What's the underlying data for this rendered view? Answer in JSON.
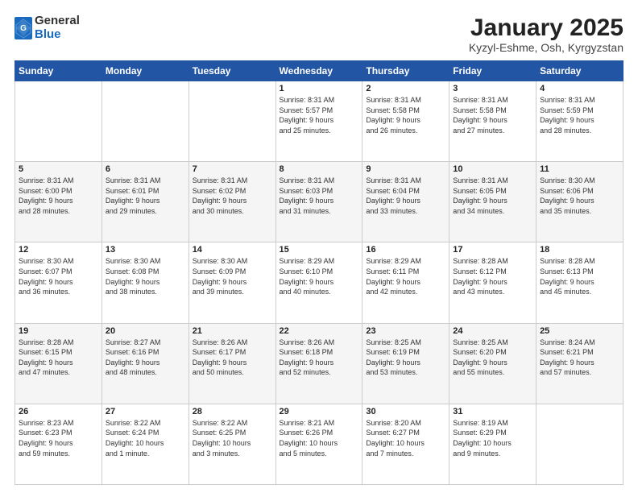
{
  "logo": {
    "general": "General",
    "blue": "Blue"
  },
  "header": {
    "title": "January 2025",
    "subtitle": "Kyzyl-Eshme, Osh, Kyrgyzstan"
  },
  "weekdays": [
    "Sunday",
    "Monday",
    "Tuesday",
    "Wednesday",
    "Thursday",
    "Friday",
    "Saturday"
  ],
  "weeks": [
    [
      {
        "day": "",
        "info": ""
      },
      {
        "day": "",
        "info": ""
      },
      {
        "day": "",
        "info": ""
      },
      {
        "day": "1",
        "info": "Sunrise: 8:31 AM\nSunset: 5:57 PM\nDaylight: 9 hours\nand 25 minutes."
      },
      {
        "day": "2",
        "info": "Sunrise: 8:31 AM\nSunset: 5:58 PM\nDaylight: 9 hours\nand 26 minutes."
      },
      {
        "day": "3",
        "info": "Sunrise: 8:31 AM\nSunset: 5:58 PM\nDaylight: 9 hours\nand 27 minutes."
      },
      {
        "day": "4",
        "info": "Sunrise: 8:31 AM\nSunset: 5:59 PM\nDaylight: 9 hours\nand 28 minutes."
      }
    ],
    [
      {
        "day": "5",
        "info": "Sunrise: 8:31 AM\nSunset: 6:00 PM\nDaylight: 9 hours\nand 28 minutes."
      },
      {
        "day": "6",
        "info": "Sunrise: 8:31 AM\nSunset: 6:01 PM\nDaylight: 9 hours\nand 29 minutes."
      },
      {
        "day": "7",
        "info": "Sunrise: 8:31 AM\nSunset: 6:02 PM\nDaylight: 9 hours\nand 30 minutes."
      },
      {
        "day": "8",
        "info": "Sunrise: 8:31 AM\nSunset: 6:03 PM\nDaylight: 9 hours\nand 31 minutes."
      },
      {
        "day": "9",
        "info": "Sunrise: 8:31 AM\nSunset: 6:04 PM\nDaylight: 9 hours\nand 33 minutes."
      },
      {
        "day": "10",
        "info": "Sunrise: 8:31 AM\nSunset: 6:05 PM\nDaylight: 9 hours\nand 34 minutes."
      },
      {
        "day": "11",
        "info": "Sunrise: 8:30 AM\nSunset: 6:06 PM\nDaylight: 9 hours\nand 35 minutes."
      }
    ],
    [
      {
        "day": "12",
        "info": "Sunrise: 8:30 AM\nSunset: 6:07 PM\nDaylight: 9 hours\nand 36 minutes."
      },
      {
        "day": "13",
        "info": "Sunrise: 8:30 AM\nSunset: 6:08 PM\nDaylight: 9 hours\nand 38 minutes."
      },
      {
        "day": "14",
        "info": "Sunrise: 8:30 AM\nSunset: 6:09 PM\nDaylight: 9 hours\nand 39 minutes."
      },
      {
        "day": "15",
        "info": "Sunrise: 8:29 AM\nSunset: 6:10 PM\nDaylight: 9 hours\nand 40 minutes."
      },
      {
        "day": "16",
        "info": "Sunrise: 8:29 AM\nSunset: 6:11 PM\nDaylight: 9 hours\nand 42 minutes."
      },
      {
        "day": "17",
        "info": "Sunrise: 8:28 AM\nSunset: 6:12 PM\nDaylight: 9 hours\nand 43 minutes."
      },
      {
        "day": "18",
        "info": "Sunrise: 8:28 AM\nSunset: 6:13 PM\nDaylight: 9 hours\nand 45 minutes."
      }
    ],
    [
      {
        "day": "19",
        "info": "Sunrise: 8:28 AM\nSunset: 6:15 PM\nDaylight: 9 hours\nand 47 minutes."
      },
      {
        "day": "20",
        "info": "Sunrise: 8:27 AM\nSunset: 6:16 PM\nDaylight: 9 hours\nand 48 minutes."
      },
      {
        "day": "21",
        "info": "Sunrise: 8:26 AM\nSunset: 6:17 PM\nDaylight: 9 hours\nand 50 minutes."
      },
      {
        "day": "22",
        "info": "Sunrise: 8:26 AM\nSunset: 6:18 PM\nDaylight: 9 hours\nand 52 minutes."
      },
      {
        "day": "23",
        "info": "Sunrise: 8:25 AM\nSunset: 6:19 PM\nDaylight: 9 hours\nand 53 minutes."
      },
      {
        "day": "24",
        "info": "Sunrise: 8:25 AM\nSunset: 6:20 PM\nDaylight: 9 hours\nand 55 minutes."
      },
      {
        "day": "25",
        "info": "Sunrise: 8:24 AM\nSunset: 6:21 PM\nDaylight: 9 hours\nand 57 minutes."
      }
    ],
    [
      {
        "day": "26",
        "info": "Sunrise: 8:23 AM\nSunset: 6:23 PM\nDaylight: 9 hours\nand 59 minutes."
      },
      {
        "day": "27",
        "info": "Sunrise: 8:22 AM\nSunset: 6:24 PM\nDaylight: 10 hours\nand 1 minute."
      },
      {
        "day": "28",
        "info": "Sunrise: 8:22 AM\nSunset: 6:25 PM\nDaylight: 10 hours\nand 3 minutes."
      },
      {
        "day": "29",
        "info": "Sunrise: 8:21 AM\nSunset: 6:26 PM\nDaylight: 10 hours\nand 5 minutes."
      },
      {
        "day": "30",
        "info": "Sunrise: 8:20 AM\nSunset: 6:27 PM\nDaylight: 10 hours\nand 7 minutes."
      },
      {
        "day": "31",
        "info": "Sunrise: 8:19 AM\nSunset: 6:29 PM\nDaylight: 10 hours\nand 9 minutes."
      },
      {
        "day": "",
        "info": ""
      }
    ]
  ]
}
